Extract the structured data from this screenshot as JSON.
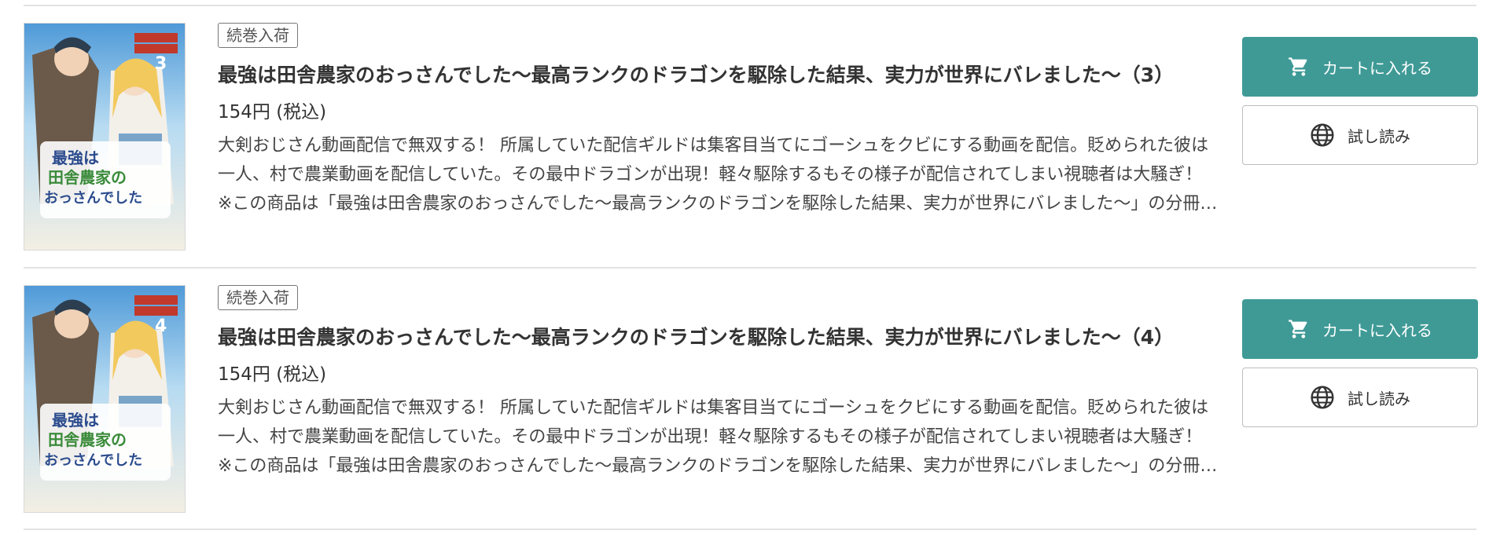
{
  "items": [
    {
      "badge": "続巻入荷",
      "title": "最強は田舎農家のおっさんでした〜最高ランクのドラゴンを駆除した結果、実力が世界にバレました〜（3）",
      "price": "154円 (税込)",
      "description": "大剣おじさん動画配信で無双する！ 所属していた配信ギルドは集客目当てにゴーシュをクビにする動画を配信。貶められた彼は一人、村で農業動画を配信していた。その最中ドラゴンが出現！軽々駆除するもその様子が配信されてしまい視聴者は大騒ぎ！ ※この商品は「最強は田舎農家のおっさんでした〜最高ランクのドラゴンを駆除した結果、実力が世界にバレました〜」の分冊版です。",
      "cart_label": "カートに入れる",
      "trial_label": "試し読み",
      "cover": {
        "volume": "3",
        "title_line1": "最強は",
        "title_line2": "田舎農家の",
        "title_line3": "おっさんでした"
      }
    },
    {
      "badge": "続巻入荷",
      "title": "最強は田舎農家のおっさんでした〜最高ランクのドラゴンを駆除した結果、実力が世界にバレました〜（4）",
      "price": "154円 (税込)",
      "description": "大剣おじさん動画配信で無双する！ 所属していた配信ギルドは集客目当てにゴーシュをクビにする動画を配信。貶められた彼は一人、村で農業動画を配信していた。その最中ドラゴンが出現！軽々駆除するもその様子が配信されてしまい視聴者は大騒ぎ！ ※この商品は「最強は田舎農家のおっさんでした〜最高ランクのドラゴンを駆除した結果、実力が世界にバレました〜」の分冊版です。",
      "cart_label": "カートに入れる",
      "trial_label": "試し読み",
      "cover": {
        "volume": "4",
        "title_line1": "最強は",
        "title_line2": "田舎農家の",
        "title_line3": "おっさんでした"
      }
    }
  ],
  "colors": {
    "cart_bg": "#3f9a96",
    "divider": "#e3e3e3"
  },
  "icons": {
    "cart": "cart-icon",
    "trial": "globe-icon"
  }
}
